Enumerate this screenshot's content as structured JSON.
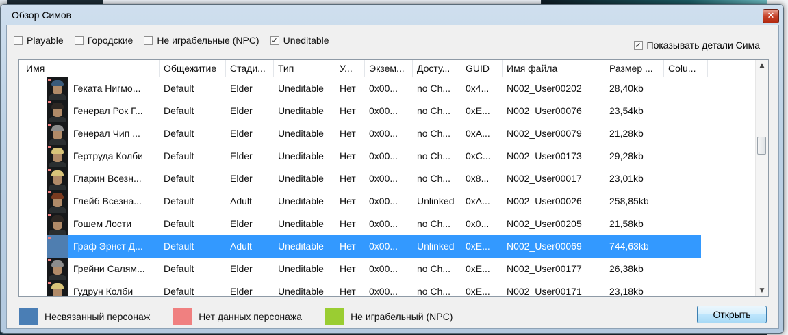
{
  "window": {
    "title": "Обзор Симов",
    "close_glyph": "✕"
  },
  "filters": [
    {
      "label": "Playable",
      "checked": false
    },
    {
      "label": "Городские",
      "checked": false
    },
    {
      "label": "Не играбельные (NPC)",
      "checked": false
    },
    {
      "label": "Uneditable",
      "checked": true
    }
  ],
  "details_toggle": {
    "label": "Показывать детали Сима",
    "checked": true
  },
  "columns": [
    "Имя",
    "Общежитие",
    "Стади...",
    "Тип",
    "У...",
    "Экзем...",
    "Досту...",
    "GUID",
    "Имя файла",
    "Размер ...",
    "Colu..."
  ],
  "rows": [
    {
      "name": "Геката Нигмо...",
      "dorm": "Default",
      "stage": "Elder",
      "type": "Uneditable",
      "u": "Нет",
      "inst": "0x00...",
      "access": "no Ch...",
      "guid": "0x4...",
      "file": "N002_User00202",
      "size": "28,40kb",
      "avatar": "blue-hair",
      "selected": false
    },
    {
      "name": "Генерал Рок Г...",
      "dorm": "Default",
      "stage": "Elder",
      "type": "Uneditable",
      "u": "Нет",
      "inst": "0x00...",
      "access": "no Ch...",
      "guid": "0xE...",
      "file": "N002_User00076",
      "size": "23,54kb",
      "avatar": "dark-hair",
      "selected": false
    },
    {
      "name": "Генерал Чип ...",
      "dorm": "Default",
      "stage": "Elder",
      "type": "Uneditable",
      "u": "Нет",
      "inst": "0x00...",
      "access": "no Ch...",
      "guid": "0xA...",
      "file": "N002_User00079",
      "size": "21,28kb",
      "avatar": "grey-hair",
      "selected": false
    },
    {
      "name": "Гертруда Колби",
      "dorm": "Default",
      "stage": "Elder",
      "type": "Uneditable",
      "u": "Нет",
      "inst": "0x00...",
      "access": "no Ch...",
      "guid": "0xC...",
      "file": "N002_User00173",
      "size": "29,28kb",
      "avatar": "blonde-hair",
      "selected": false
    },
    {
      "name": "Гларин Всезн...",
      "dorm": "Default",
      "stage": "Elder",
      "type": "Uneditable",
      "u": "Нет",
      "inst": "0x00...",
      "access": "no Ch...",
      "guid": "0x8...",
      "file": "N002_User00017",
      "size": "23,01kb",
      "avatar": "blonde-hair",
      "selected": false
    },
    {
      "name": "Глейб Всезна...",
      "dorm": "Default",
      "stage": "Adult",
      "type": "Uneditable",
      "u": "Нет",
      "inst": "0x00...",
      "access": "Unlinked",
      "guid": "0xA...",
      "file": "N002_User00026",
      "size": "258,85kb",
      "avatar": "red-hair",
      "selected": false
    },
    {
      "name": "Гошем Лости",
      "dorm": "Default",
      "stage": "Elder",
      "type": "Uneditable",
      "u": "Нет",
      "inst": "0x00...",
      "access": "no Ch...",
      "guid": "0x0...",
      "file": "N002_User00205",
      "size": "21,58kb",
      "avatar": "dark-hair",
      "selected": false
    },
    {
      "name": "Граф Эрнст Д...",
      "dorm": "Default",
      "stage": "Adult",
      "type": "Uneditable",
      "u": "Нет",
      "inst": "0x00...",
      "access": "Unlinked",
      "guid": "0xE...",
      "file": "N002_User00069",
      "size": "744,63kb",
      "avatar": "unlinked",
      "selected": true
    },
    {
      "name": "Грейни Салям...",
      "dorm": "Default",
      "stage": "Elder",
      "type": "Uneditable",
      "u": "Нет",
      "inst": "0x00...",
      "access": "no Ch...",
      "guid": "0xE...",
      "file": "N002_User00177",
      "size": "26,38kb",
      "avatar": "grey-hair",
      "selected": false
    },
    {
      "name": "Гудрун Колби",
      "dorm": "Default",
      "stage": "Elder",
      "type": "Uneditable",
      "u": "Нет",
      "inst": "0x00...",
      "access": "no Ch...",
      "guid": "0xE...",
      "file": "N002_User00171",
      "size": "23,18kb",
      "avatar": "blonde-hair",
      "selected": false
    }
  ],
  "legend": [
    {
      "label": "Несвязанный персонаж",
      "color": "#4a7eb5"
    },
    {
      "label": "Нет данных персонажа",
      "color": "#f08080"
    },
    {
      "label": "Не играбельный (NPC)",
      "color": "#9acd32"
    }
  ],
  "open_button": "Открыть",
  "colors": {
    "selection": "#3399ff"
  }
}
